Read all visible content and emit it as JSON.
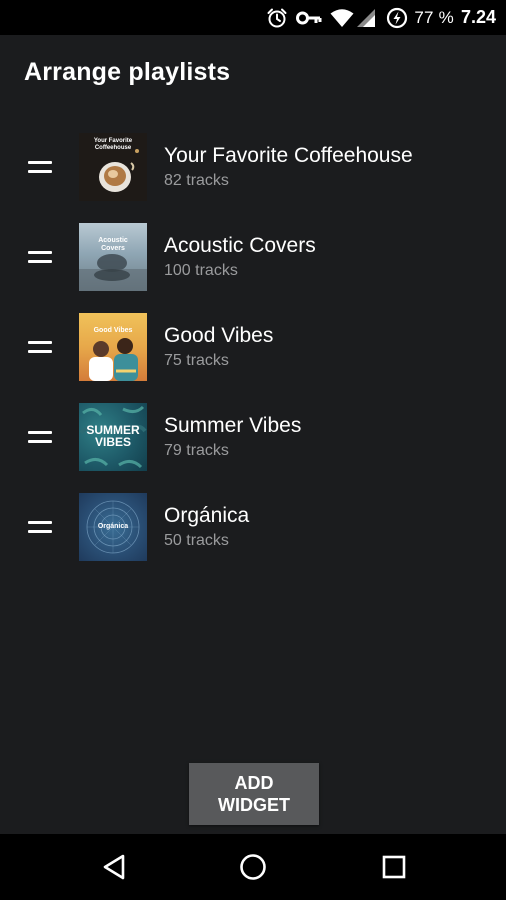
{
  "status_bar": {
    "battery_percent": "77 %",
    "time": "7.24",
    "icons": [
      "alarm-icon",
      "vpn-key-icon",
      "wifi-icon",
      "cell-signal-icon",
      "battery-charging-icon"
    ]
  },
  "page": {
    "title": "Arrange playlists"
  },
  "playlists": [
    {
      "title": "Your Favorite Coffeehouse",
      "tracks": "82 tracks",
      "cover_text": "Your Favorite Coffeehouse"
    },
    {
      "title": "Acoustic Covers",
      "tracks": "100 tracks",
      "cover_text": "Acoustic Covers"
    },
    {
      "title": "Good Vibes",
      "tracks": "75 tracks",
      "cover_text": "Good Vibes"
    },
    {
      "title": "Summer Vibes",
      "tracks": "79 tracks",
      "cover_text": "SUMMER VIBES"
    },
    {
      "title": "Orgánica",
      "tracks": "50 tracks",
      "cover_text": "Orgánica"
    }
  ],
  "actions": {
    "add_widget_label": "ADD\nWIDGET"
  },
  "nav": {
    "icons": [
      "back-icon",
      "home-icon",
      "recents-icon"
    ]
  },
  "colors": {
    "background": "#1b1c1e",
    "status_bar": "#000000",
    "secondary_text": "#9a9b9d",
    "button": "#58595b"
  }
}
